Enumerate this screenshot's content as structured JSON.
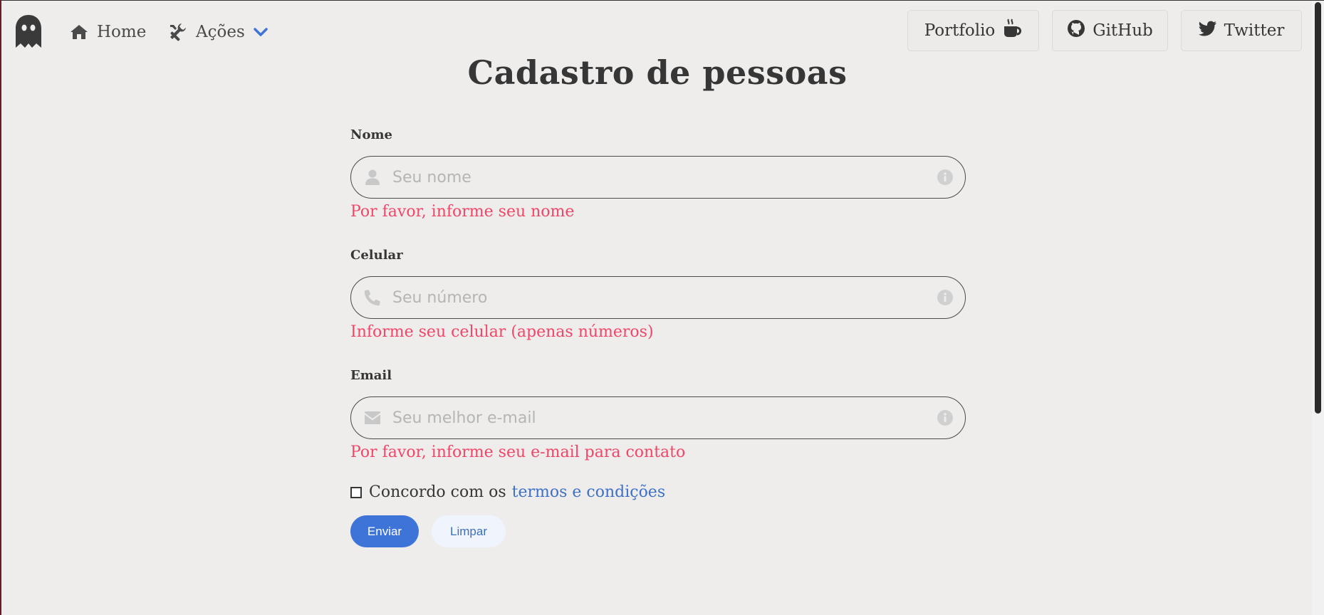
{
  "nav": {
    "home_label": "Home",
    "acoes_label": "Ações",
    "portfolio_label": "Portfolio",
    "github_label": "GitHub",
    "twitter_label": "Twitter"
  },
  "page": {
    "title": "Cadastro de pessoas"
  },
  "form": {
    "fields": [
      {
        "label": "Nome",
        "placeholder": "Seu nome",
        "value": "",
        "help": "Por favor, informe seu nome",
        "icon": "user-icon"
      },
      {
        "label": "Celular",
        "placeholder": "Seu número",
        "value": "",
        "help": "Informe seu celular (apenas números)",
        "icon": "phone-icon"
      },
      {
        "label": "Email",
        "placeholder": "Seu melhor e-mail",
        "value": "",
        "help": "Por favor, informe seu e-mail para contato",
        "icon": "envelope-icon"
      }
    ],
    "terms_text": "Concordo com os",
    "terms_link": "termos e condições",
    "terms_checked": false,
    "submit_label": "Enviar",
    "clear_label": "Limpar"
  },
  "colors": {
    "background": "#eeedeb",
    "danger": "#f14668",
    "primary": "#3e73d8",
    "link": "#3e70c9",
    "accent_chevron": "#3e73d8"
  }
}
